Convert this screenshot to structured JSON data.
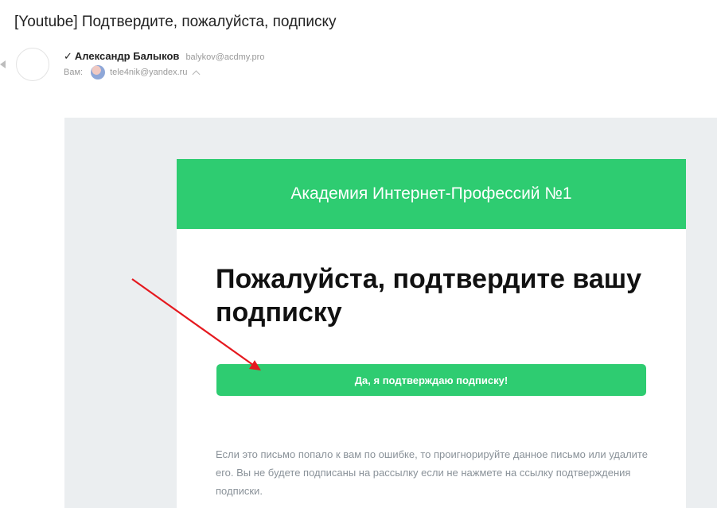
{
  "email": {
    "subject": "[Youtube] Подтвердите, пожалуйста, подписку",
    "from": {
      "check_mark": "✓",
      "name": "Александр Балыков",
      "email": "balykov@acdmy.pro"
    },
    "to": {
      "label": "Вам:",
      "email": "tele4nik@yandex.ru"
    }
  },
  "message": {
    "banner_title": "Академия Интернет-Профессий №1",
    "headline": "Пожалуйста, подтвердите вашу подписку",
    "confirm_button": "Да, я подтверждаю подписку!",
    "footer_note": "Если это письмо попало к вам по ошибке, то проигнорируйте данное письмо или удалите его. Вы не будете подписаны на рассылку если не нажмете на ссылку подтверждения подписки."
  },
  "colors": {
    "accent_green": "#2ecc71",
    "page_background": "#ebeef0",
    "annotation_arrow": "#e5191f"
  }
}
